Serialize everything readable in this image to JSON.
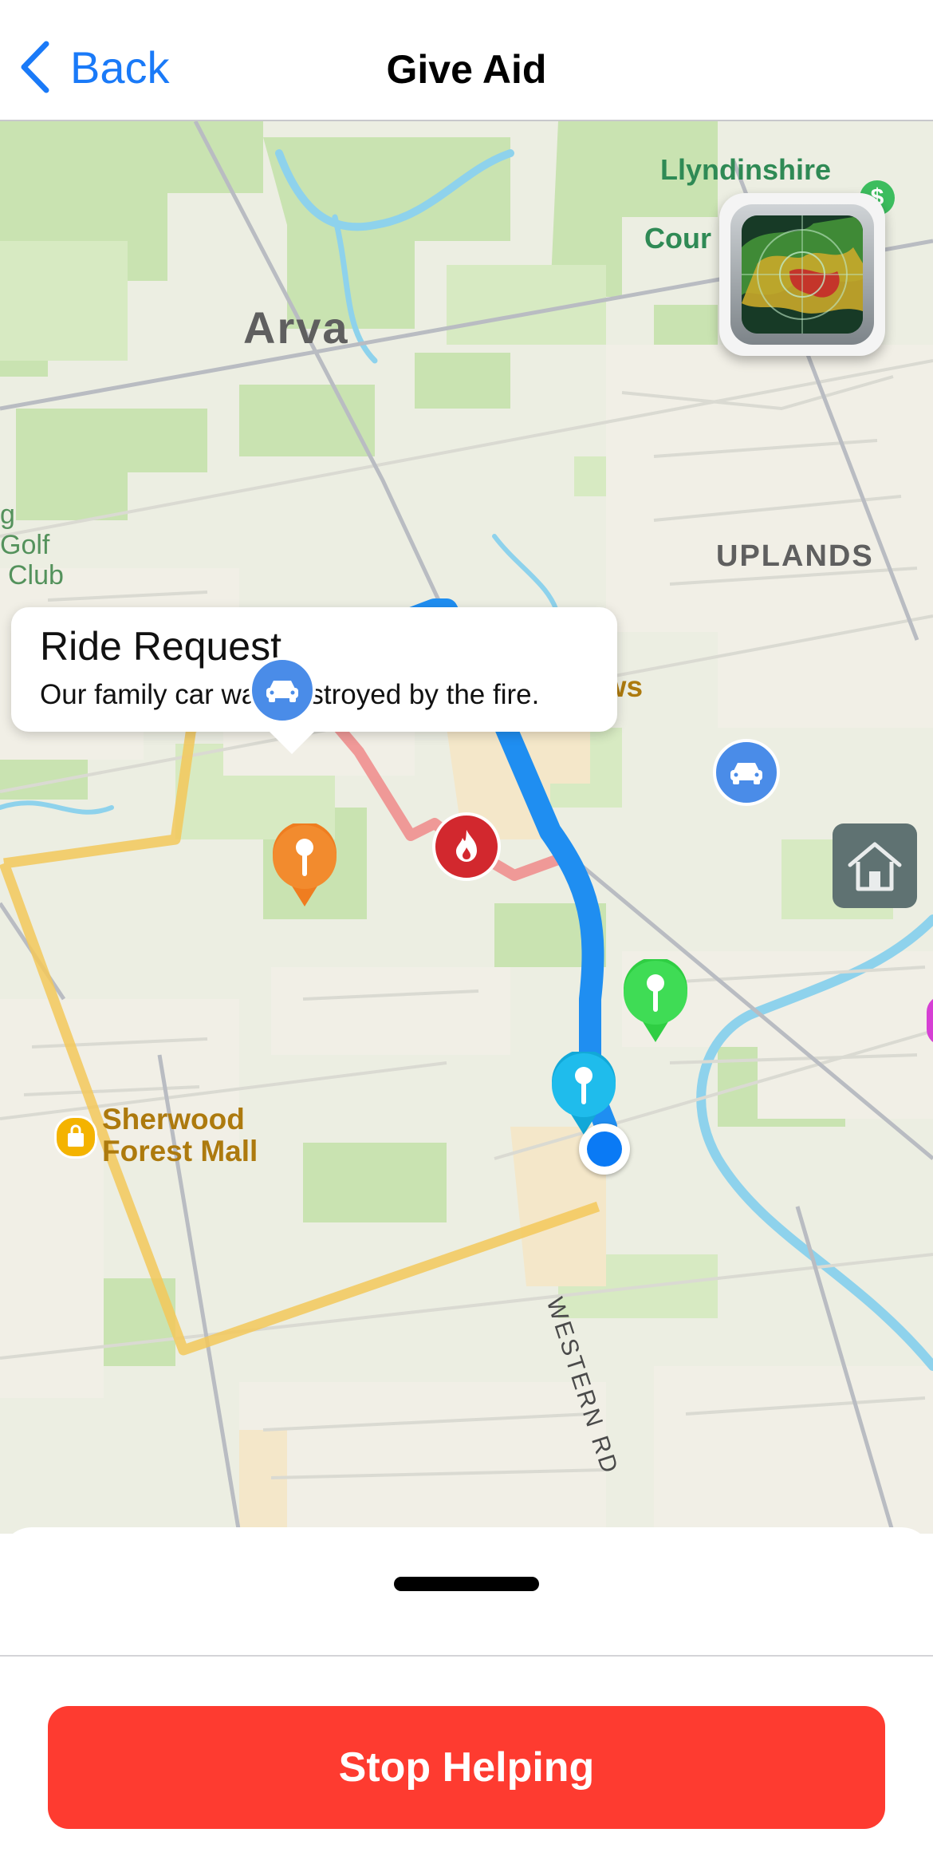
{
  "nav": {
    "back_label": "Back",
    "title": "Give Aid"
  },
  "map": {
    "place_labels": {
      "llyndinshire": "Llyndinshire",
      "cour": "Cour",
      "arva": "Arva",
      "uplands": "UPLANDS",
      "loblaws": "Loblaws",
      "sherwood_line1": "Sherwood",
      "sherwood_line2": "Forest Mall",
      "western_rd": "WESTERN RD",
      "golf_fragment_1": "g",
      "golf_fragment_2": "Golf",
      "golf_fragment_3": "Club"
    },
    "callout": {
      "title": "Ride Request",
      "subtitle": "Our family car was destroyed by the fire."
    },
    "colors": {
      "route": "#1f8ef1",
      "fire_route": "#f08a8a",
      "boundary": "#f3c85a",
      "fire_marker": "#d2282e",
      "ride_marker": "#4a8ce8"
    },
    "icons": [
      "chevron-left-icon",
      "car-icon",
      "flame-icon",
      "shopping-cart-icon",
      "shopping-bag-icon",
      "home-icon",
      "radar-icon",
      "map-pin-icon",
      "user-location-icon"
    ]
  },
  "actions": {
    "stop_label": "Stop Helping"
  }
}
